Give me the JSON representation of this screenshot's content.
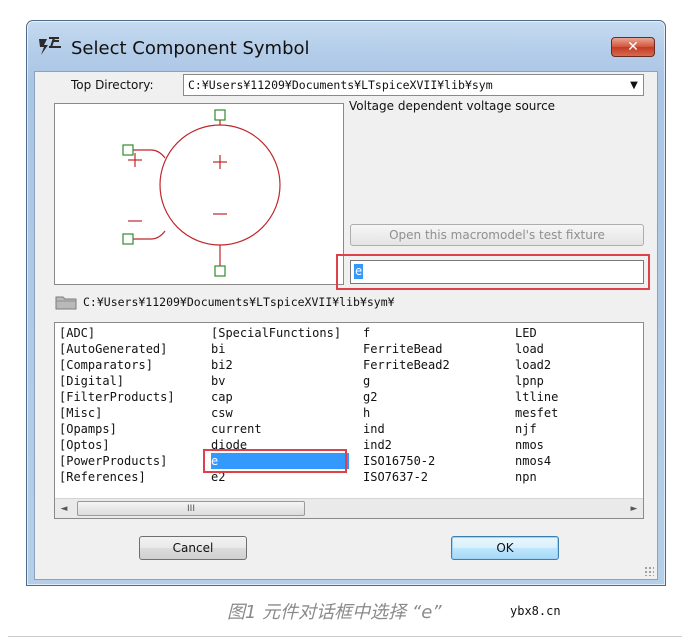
{
  "window": {
    "title": "Select Component Symbol",
    "close_glyph": "✕"
  },
  "top_directory": {
    "label": "Top Directory:",
    "value": "C:¥Users¥11209¥Documents¥LTspiceXVII¥lib¥sym",
    "arrow": "▼"
  },
  "symbol": {
    "description": "Voltage dependent voltage source",
    "plus": "+",
    "minus": "−",
    "pin_color": "#2e8b2e",
    "body_color": "#c0262a"
  },
  "test_fixture_button": "Open this macromodel's test fixture",
  "name_input": {
    "value": "e"
  },
  "current_path": "C:¥Users¥11209¥Documents¥LTspiceXVII¥lib¥sym¥",
  "list": {
    "columns": [
      [
        "[ADC]",
        "[AutoGenerated]",
        "[Comparators]",
        "[Digital]",
        "[FilterProducts]",
        "[Misc]",
        "[Opamps]",
        "[Optos]",
        "[PowerProducts]",
        "[References]"
      ],
      [
        "[SpecialFunctions]",
        "bi",
        "bi2",
        "bv",
        "cap",
        "csw",
        "current",
        "diode",
        "e",
        "e2"
      ],
      [
        "f",
        "FerriteBead",
        "FerriteBead2",
        "g",
        "g2",
        "h",
        "ind",
        "ind2",
        "ISO16750-2",
        "ISO7637-2"
      ],
      [
        "LED",
        "load",
        "load2",
        "lpnp",
        "ltline",
        "mesfet",
        "njf",
        "nmos",
        "nmos4",
        "npn"
      ]
    ],
    "selected": "e",
    "scroll_left": "◄",
    "scroll_right": "►",
    "thumb_grip": "III"
  },
  "buttons": {
    "cancel": "Cancel",
    "ok": "OK"
  },
  "caption": {
    "text": "图1 元件对话框中选择 “e”",
    "site": "ybx8.cn"
  },
  "colors": {
    "highlight_frame": "#e0404a",
    "selection": "#3399ff"
  }
}
